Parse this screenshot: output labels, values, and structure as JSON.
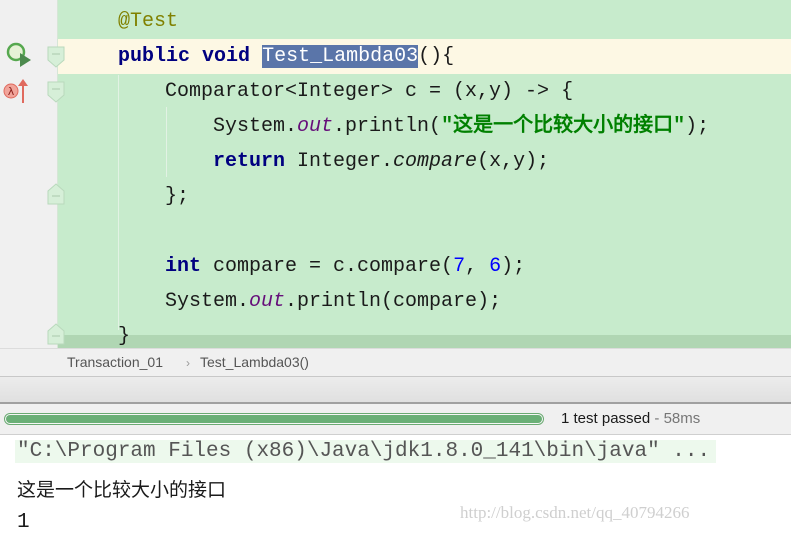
{
  "editor": {
    "lines": {
      "annotation": "@Test",
      "method_kw1": "public",
      "method_kw2": "void",
      "method_name": "Test_Lambda03",
      "method_tail": "(){",
      "comparator_decl": "Comparator<Integer> c = (x,y) -> {",
      "println_prefix": "System.",
      "println_field": "out",
      "println_mid": ".println(",
      "println_string": "\"这是一个比较大小的接口\"",
      "println_end": ");",
      "return_kw": "return",
      "return_prefix": " Integer.",
      "return_method": "compare",
      "return_end": "(x,y);",
      "lambda_close": "};",
      "int_kw": "int",
      "int_mid": " compare = c.compare(",
      "int_arg1": "7",
      "int_sep": ", ",
      "int_arg2": "6",
      "int_end": ");",
      "print2_prefix": "System.",
      "print2_field": "out",
      "print2_end": ".println(compare);",
      "method_close": "}"
    }
  },
  "gutter": {
    "run_icon": "run-test-icon",
    "lambda_icon": "lambda-implementation-icon"
  },
  "breadcrumb": {
    "items": [
      "Transaction_01",
      "Test_Lambda03()"
    ],
    "separator": "›"
  },
  "test_status": {
    "progress_percent": 100,
    "result": "1 test passed",
    "duration": " - 58ms",
    "accent_color": "#6aaf76"
  },
  "console": {
    "command": "\"C:\\Program Files (x86)\\Java\\jdk1.8.0_141\\bin\\java\" ...",
    "output_lines": [
      "这是一个比较大小的接口",
      "1"
    ]
  },
  "watermark": "http://blog.csdn.net/qq_40794266"
}
